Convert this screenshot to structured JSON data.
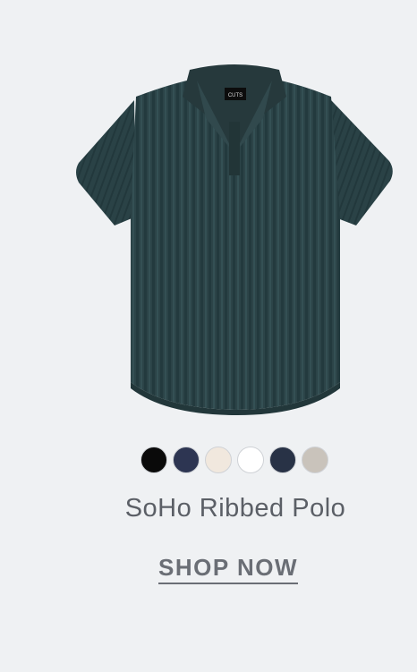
{
  "product": {
    "name": "SoHo Ribbed Polo",
    "cta_label": "SHOP NOW",
    "image_icon": "polo-shirt-image",
    "shirt_color": "#2c4448",
    "label_text": "CUTS"
  },
  "swatches": [
    {
      "name": "black",
      "color": "#0a0a0a"
    },
    {
      "name": "navy",
      "color": "#2d3552"
    },
    {
      "name": "cream",
      "color": "#f1e8de"
    },
    {
      "name": "white",
      "color": "#ffffff"
    },
    {
      "name": "dark-navy",
      "color": "#283246"
    },
    {
      "name": "stone",
      "color": "#c9c3bb"
    }
  ]
}
